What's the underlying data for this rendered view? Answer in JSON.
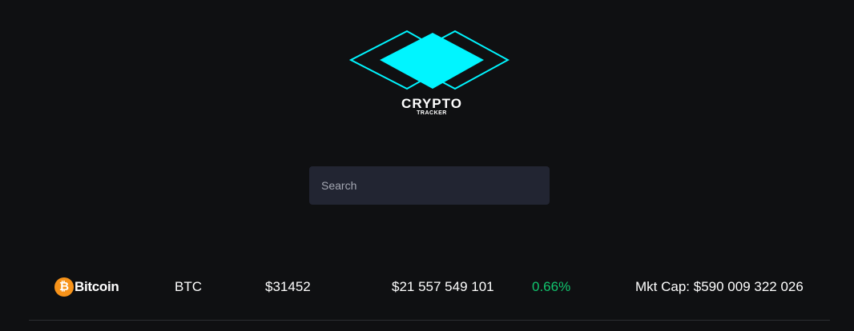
{
  "logo": {
    "title": "CRYPTO",
    "subtitle": "TRACKER",
    "accent_color": "#00f5ff"
  },
  "search": {
    "placeholder": "Search",
    "value": ""
  },
  "coins": [
    {
      "icon": "bitcoin-icon",
      "icon_glyph": "₿",
      "icon_color": "#f7931a",
      "name": "Bitcoin",
      "symbol": "BTC",
      "price": "$31452",
      "volume": "$21 557 549 101",
      "change": "0.66%",
      "change_color": "#11c56e",
      "market_cap": "Mkt Cap: $590 009 322 026"
    }
  ]
}
